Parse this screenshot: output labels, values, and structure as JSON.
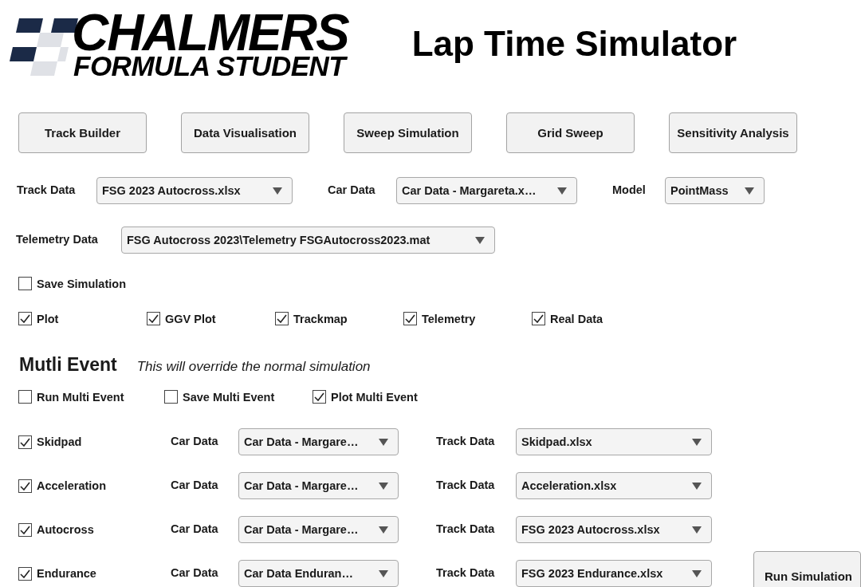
{
  "logo": {
    "line_1": "CHALMERS",
    "line_2": "FORMULA STUDENT"
  },
  "title": "Lap Time Simulator",
  "nav_buttons": [
    "Track Builder",
    "Data Visualisation",
    "Sweep Simulation",
    "Grid Sweep",
    "Sensitivity Analysis"
  ],
  "selectors": [
    {
      "label": "Track Data",
      "value": "FSG 2023 Autocross.xlsx"
    },
    {
      "label": "Car Data",
      "value": "Car Data - Margareta.x…"
    },
    {
      "label": "Model",
      "value": "PointMass"
    }
  ],
  "telemetry": {
    "label": "Telemetry Data",
    "value": "FSG Autocross 2023\\Telemetry FSGAutocross2023.mat"
  },
  "save_simulation": {
    "label": "Save Simulation",
    "checked": false
  },
  "plot_options": [
    {
      "label": "Plot",
      "checked": true
    },
    {
      "label": "GGV Plot",
      "checked": true
    },
    {
      "label": "Trackmap",
      "checked": true
    },
    {
      "label": "Telemetry",
      "checked": true
    },
    {
      "label": "Real Data",
      "checked": true
    }
  ],
  "multi_event": {
    "heading": "Mutli Event",
    "note": "This will override the normal simulation",
    "options": [
      {
        "label": "Run Multi Event",
        "checked": false
      },
      {
        "label": "Save Multi Event",
        "checked": false
      },
      {
        "label": "Plot Multi Event",
        "checked": true
      }
    ],
    "events": [
      {
        "name": "Skidpad",
        "checked": true,
        "car_label": "Car Data",
        "car_value": "Car Data - Margare…",
        "track_label": "Track Data",
        "track_value": "Skidpad.xlsx"
      },
      {
        "name": "Acceleration",
        "checked": true,
        "car_label": "Car Data",
        "car_value": "Car Data - Margare…",
        "track_label": "Track Data",
        "track_value": "Acceleration.xlsx"
      },
      {
        "name": "Autocross",
        "checked": true,
        "car_label": "Car Data",
        "car_value": "Car Data - Margare…",
        "track_label": "Track Data",
        "track_value": "FSG 2023 Autocross.xlsx"
      },
      {
        "name": "Endurance",
        "checked": true,
        "car_label": "Car Data",
        "car_value": "Car Data Enduran…",
        "track_label": "Track Data",
        "track_value": "FSG 2023 Endurance.xlsx"
      }
    ]
  },
  "run_button": "Run Simulation"
}
